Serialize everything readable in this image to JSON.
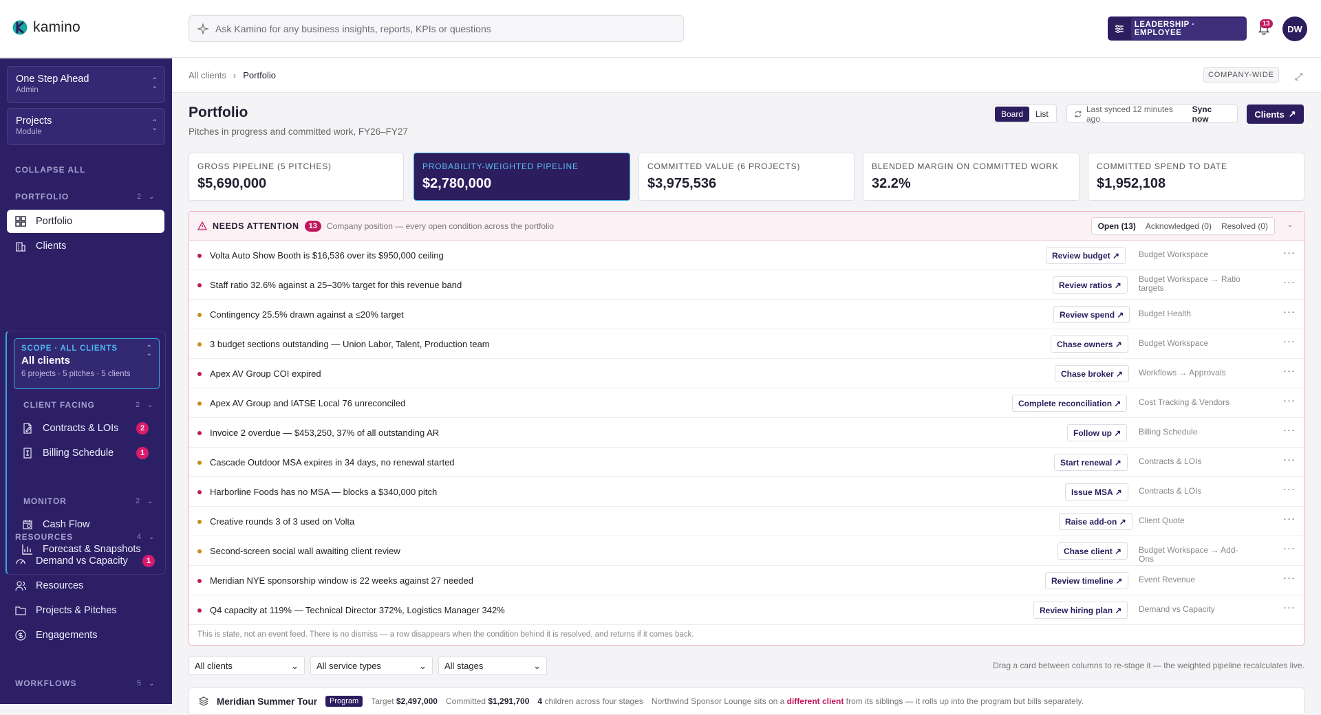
{
  "app": {
    "brand": "kamino",
    "search_placeholder": "Ask Kamino for any business insights, reports, KPIs or questions",
    "role_label": "LEADERSHIP · EMPLOYEE",
    "notif_count": "13",
    "avatar_initials": "DW",
    "accent": "#2b1d5e",
    "alert": "#c0185f"
  },
  "sidebar": {
    "org": {
      "title": "One Step Ahead",
      "sub": "Admin"
    },
    "module": {
      "title": "Projects",
      "sub": "Module"
    },
    "collapse_all": "COLLAPSE ALL",
    "portfolio": {
      "label": "PORTFOLIO",
      "count": "2",
      "items": [
        {
          "label": "Portfolio",
          "icon": "grid-icon"
        },
        {
          "label": "Clients",
          "icon": "building-icon"
        }
      ]
    },
    "scope": {
      "kicker": "SCOPE · ALL CLIENTS",
      "value": "All clients",
      "meta": "6 projects · 5 pitches · 5 clients"
    },
    "client_facing": {
      "label": "CLIENT FACING",
      "count": "2",
      "items": [
        {
          "label": "Contracts & LOIs",
          "badge": "2"
        },
        {
          "label": "Billing Schedule",
          "badge": "1"
        }
      ]
    },
    "monitor": {
      "label": "MONITOR",
      "count": "2",
      "items": [
        {
          "label": "Cash Flow"
        },
        {
          "label": "Forecast & Snapshots"
        }
      ]
    },
    "resources": {
      "label": "RESOURCES",
      "count": "4",
      "items": [
        {
          "label": "Demand vs Capacity",
          "badge": "1"
        },
        {
          "label": "Resources"
        },
        {
          "label": "Projects & Pitches"
        },
        {
          "label": "Engagements"
        }
      ]
    },
    "workflows": {
      "label": "WORKFLOWS",
      "count": "5"
    }
  },
  "header": {
    "breadcrumb_root": "All clients",
    "breadcrumb_current": "Portfolio",
    "scope_tag": "COMPANY-WIDE"
  },
  "page": {
    "title": "Portfolio",
    "subtitle": "Pitches in progress and committed work, FY26–FY27",
    "view_board": "Board",
    "view_list": "List",
    "synced": "Last synced 12 minutes ago",
    "sync_now": "Sync now",
    "clients_btn": "Clients"
  },
  "kpis": [
    {
      "label": "GROSS PIPELINE (5 PITCHES)",
      "value": "$5,690,000"
    },
    {
      "label": "PROBABILITY-WEIGHTED PIPELINE",
      "value": "$2,780,000"
    },
    {
      "label": "COMMITTED VALUE (6 PROJECTS)",
      "value": "$3,975,536"
    },
    {
      "label": "BLENDED MARGIN ON COMMITTED WORK",
      "value": "32.2%"
    },
    {
      "label": "COMMITTED SPEND TO DATE",
      "value": "$1,952,108"
    }
  ],
  "attention": {
    "title": "NEEDS ATTENTION",
    "count": "13",
    "desc": "Company position — every open condition across the portfolio",
    "tab_open": "Open (13)",
    "tab_ack": "Acknowledged (0)",
    "tab_resolved": "Resolved (0)",
    "footer": "This is state, not an event feed. There is no dismiss — a row disappears when the condition behind it is resolved, and returns if it comes back.",
    "rows": [
      {
        "text": "Volta Auto Show Booth is $16,536 over its $950,000 ceiling",
        "action": "Review budget",
        "dest": "Budget Workspace",
        "severity": "#c0185f"
      },
      {
        "text": "Staff ratio 32.6% against a 25–30% target for this revenue band",
        "action": "Review ratios",
        "dest": "Budget Workspace → Ratio targets",
        "severity": "#c0185f"
      },
      {
        "text": "Contingency 25.5% drawn against a ≤20% target",
        "action": "Review spend",
        "dest": "Budget Health",
        "severity": "#c98a1a"
      },
      {
        "text": "3 budget sections outstanding — Union Labor, Talent, Production team",
        "action": "Chase owners",
        "dest": "Budget Workspace",
        "severity": "#c98a1a"
      },
      {
        "text": "Apex AV Group COI expired",
        "action": "Chase broker",
        "dest": "Workflows → Approvals",
        "severity": "#c0185f"
      },
      {
        "text": "Apex AV Group and IATSE Local 76 unreconciled",
        "action": "Complete reconciliation",
        "dest": "Cost Tracking & Vendors",
        "severity": "#c98a1a"
      },
      {
        "text": "Invoice 2 overdue — $453,250, 37% of all outstanding AR",
        "action": "Follow up",
        "dest": "Billing Schedule",
        "severity": "#c0185f"
      },
      {
        "text": "Cascade Outdoor MSA expires in 34 days, no renewal started",
        "action": "Start renewal",
        "dest": "Contracts & LOIs",
        "severity": "#c98a1a"
      },
      {
        "text": "Harborline Foods has no MSA — blocks a $340,000 pitch",
        "action": "Issue MSA",
        "dest": "Contracts & LOIs",
        "severity": "#c0185f"
      },
      {
        "text": "Creative rounds 3 of 3 used on Volta",
        "action": "Raise add-on",
        "dest": "Client Quote",
        "severity": "#c98a1a"
      },
      {
        "text": "Second-screen social wall awaiting client review",
        "action": "Chase client",
        "dest": "Budget Workspace → Add-Ons",
        "severity": "#c98a1a"
      },
      {
        "text": "Meridian NYE sponsorship window is 22 weeks against 27 needed",
        "action": "Review timeline",
        "dest": "Event Revenue",
        "severity": "#c0185f"
      },
      {
        "text": "Q4 capacity at 119% — Technical Director 372%, Logistics Manager 342%",
        "action": "Review hiring plan",
        "dest": "Demand vs Capacity",
        "severity": "#c0185f"
      }
    ]
  },
  "filters": {
    "clients": "All clients",
    "service_types": "All service types",
    "stages": "All stages",
    "hint": "Drag a card between columns to re-stage it — the weighted pipeline recalculates live."
  },
  "program": {
    "title": "Meridian Summer Tour",
    "tag": "Program",
    "target_label": "Target",
    "target": "$2,497,000",
    "committed_label": "Committed",
    "committed": "$1,291,700",
    "children_n": "4",
    "children_text": "children across four stages",
    "note_a": "Northwind Sponsor Lounge sits on a",
    "note_link": "different client",
    "note_b": "from its siblings — it rolls up into the program but bills separately."
  }
}
